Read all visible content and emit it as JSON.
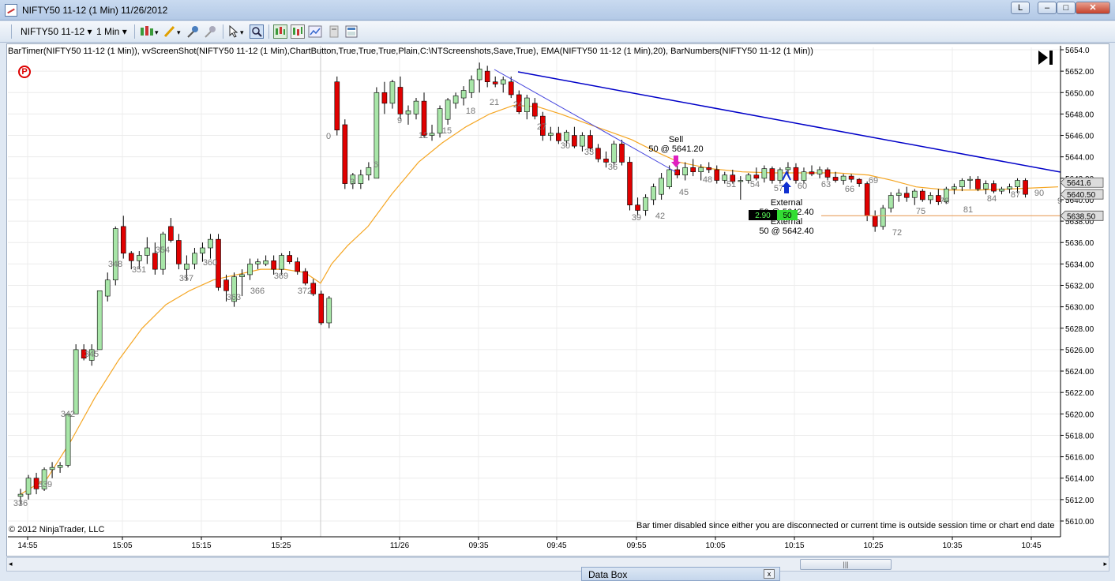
{
  "window": {
    "title": "NIFTY50 11-12 (1 Min)  11/26/2012",
    "layout_btn": "L",
    "minimize": "–",
    "maximize": "□",
    "close": "✕"
  },
  "toolbar": {
    "instrument": "NIFTY50 11-12",
    "interval": "1 Min",
    "dropdown_glyph": "▾",
    "icons": [
      "bar-type-icon",
      "drawing-pencil-icon",
      "add-marker-icon",
      "remove-marker-icon",
      "cursor-icon",
      "zoom-icon",
      "strategies-icon",
      "indicators-icon",
      "chart-properties-icon",
      "data-series-icon",
      "template-icon"
    ]
  },
  "chart": {
    "indicator_line": "BarTimer(NIFTY50 11-12 (1 Min)), vvScreenShot(NIFTY50 11-12 (1 Min),ChartButton,True,True,True,Plain,C:\\NTScreenshots,Save,True), EMA(NIFTY50 11-12 (1 Min),20), BarNumbers(NIFTY50 11-12 (1 Min))",
    "p_marker": "P",
    "copyright": "© 2012 NinjaTrader, LLC",
    "bar_timer_msg": "Bar timer disabled since either you are disconnected or current time is outside session time or chart end date",
    "price_labels": [
      "5654.0",
      "5652.00",
      "5650.00",
      "5648.00",
      "5646.00",
      "5644.00",
      "5642.00",
      "5640.00",
      "5638.00",
      "5636.00",
      "5634.00",
      "5632.00",
      "5630.00",
      "5628.00",
      "5626.00",
      "5624.00",
      "5622.00",
      "5620.00",
      "5618.00",
      "5616.00",
      "5614.00",
      "5612.00",
      "5610.00"
    ],
    "price_flags": [
      "5641.6",
      "5640.50",
      "5638.50"
    ],
    "time_labels": [
      "14:55",
      "15:05",
      "15:15",
      "15:25",
      "11/26",
      "09:35",
      "09:45",
      "09:55",
      "10:05",
      "10:15",
      "10:25",
      "10:35",
      "10:45"
    ],
    "bar_numbers": [
      "336",
      "339",
      "342",
      "345",
      "348",
      "351",
      "354",
      "357",
      "360",
      "363",
      "366",
      "369",
      "372",
      "0",
      "3",
      "6",
      "9",
      "12",
      "15",
      "18",
      "21",
      "24",
      "27",
      "30",
      "33",
      "36",
      "39",
      "42",
      "45",
      "48",
      "51",
      "54",
      "57",
      "60",
      "63",
      "66",
      "69",
      "72",
      "75",
      "78",
      "81",
      "84",
      "87",
      "90",
      "9"
    ],
    "sell_label": "Sell",
    "sell_fill": "50 @ 5641.20",
    "ext_label_1": "External",
    "ext_fill_1": "50 @ 5642.40",
    "ext_label_2": "External",
    "ext_fill_2": "50 @ 5642.40",
    "position_pnl": "2.90",
    "position_qty": "50",
    "colors": {
      "up": "#a8e6a8",
      "down": "#e00000",
      "ema": "#f5a623",
      "trend": "#0000c8",
      "pos_line": "#e8a060"
    }
  },
  "chart_data": {
    "type": "candlestick",
    "y_axis_ticks": [
      5610,
      5612,
      5614,
      5616,
      5618,
      5620,
      5622,
      5624,
      5626,
      5628,
      5630,
      5632,
      5634,
      5636,
      5638,
      5640,
      5642,
      5644,
      5646,
      5648,
      5650,
      5652,
      5654
    ],
    "ylim": [
      5609,
      5655
    ],
    "series": [
      {
        "name": "EMA(NIFTY50 11-12 (1 Min),20)",
        "type": "line"
      }
    ]
  },
  "databox": {
    "title": "Data Box",
    "close": "x"
  },
  "scroll": {
    "thumb": "|||"
  }
}
